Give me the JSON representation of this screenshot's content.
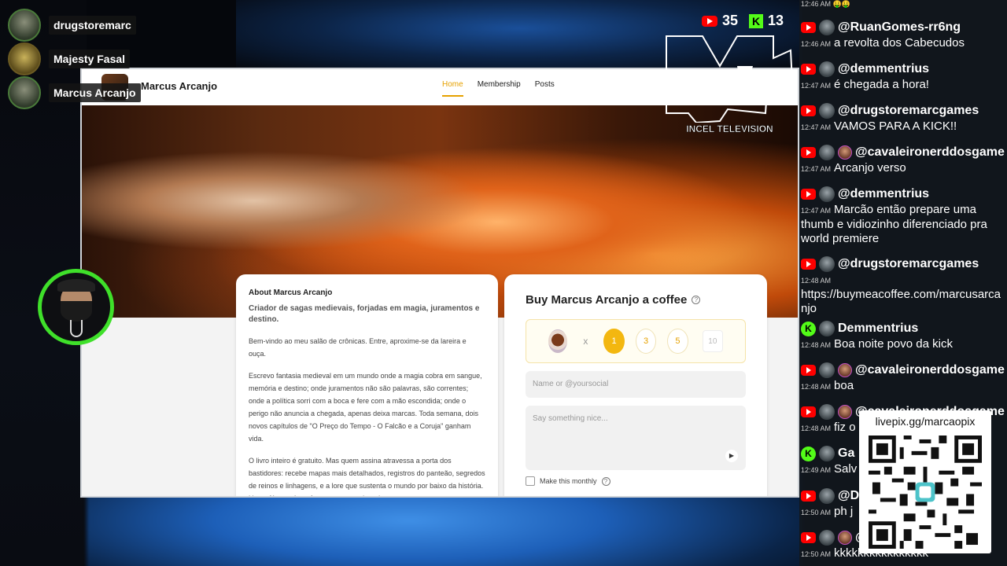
{
  "viewers": [
    {
      "name": "drugstoremarc"
    },
    {
      "name": "Majesty Fasal"
    },
    {
      "name": "Marcus Arcanjo"
    }
  ],
  "counters": {
    "youtube": "35",
    "kick": "13",
    "kick_letter": "K"
  },
  "mtv": {
    "caption": "INCEL TELEVISION"
  },
  "site": {
    "title": "Marcus Arcanjo",
    "nav": [
      "Home",
      "Membership",
      "Posts"
    ]
  },
  "about": {
    "heading": "About Marcus Arcanjo",
    "subtitle": "Criador de sagas medievais, forjadas em magia, juramentos e destino.",
    "paragraphs": [
      "Bem-vindo ao meu salão de crônicas. Entre, aproxime-se da lareira e ouça.",
      "Escrevo fantasia medieval em um mundo onde a magia cobra em sangue, memória e destino; onde juramentos não são palavras, são correntes; onde a política sorri com a boca e fere com a mão escondida; onde o perigo não anuncia a chegada, apenas deixa marcas. Toda semana, dois novos capítulos de \"O Preço do Tempo - O Falcão e a Coruja\" ganham vida.",
      "O livro inteiro é gratuito. Mas quem assina atravessa a porta dos bastidores: recebe mapas mais detalhados, registros do panteão, segredos de reinos e linhagens, e a lore que sustenta o mundo por baixo da história. Um café mantém o fogo aceso, e a tinta do"
    ]
  },
  "coffee": {
    "title": "Buy Marcus Arcanjo a coffee",
    "help": "?",
    "times": "x",
    "amounts": [
      "1",
      "3",
      "5"
    ],
    "custom_amount": "10",
    "name_placeholder": "Name or @yoursocial",
    "message_placeholder": "Say something nice...",
    "monthly_label": "Make this monthly"
  },
  "chat": {
    "first_time": "12:46 AM",
    "first_emotes": "🤑🤑",
    "messages": [
      {
        "platform": "yt",
        "user": "@RuanGomes-rr6ng",
        "time": "12:46 AM",
        "text": "a revolta dos Cabecudos"
      },
      {
        "platform": "yt",
        "user": "@demmentrius",
        "time": "12:47 AM",
        "text": "é chegada a hora!"
      },
      {
        "platform": "yt",
        "user": "@drugstoremarcgames",
        "time": "12:47 AM",
        "text": "VAMOS PARA A KICK!!"
      },
      {
        "platform": "yt",
        "user": "@cavaleironerddosgame",
        "time": "12:47 AM",
        "text": "Arcanjo verso"
      },
      {
        "platform": "yt",
        "user": "@demmentrius",
        "time": "12:47 AM",
        "text": "Marcão então prepare uma thumb e vidiozinho diferenciado pra world premiere"
      },
      {
        "platform": "yt",
        "user": "@drugstoremarcgames",
        "time": "12:48 AM",
        "text": "https://buymeacoffee.com/marcusarcanjo"
      },
      {
        "platform": "kick",
        "user": "Demmentrius",
        "time": "12:48 AM",
        "text": "Boa noite povo da kick"
      },
      {
        "platform": "yt",
        "user": "@cavaleironerddosgame",
        "time": "12:48 AM",
        "text": "boa"
      },
      {
        "platform": "yt",
        "user": "@cavaleironerddosgame",
        "time": "12:48 AM",
        "text": "fiz o"
      },
      {
        "platform": "kick",
        "user": "Ga",
        "time": "12:49 AM",
        "text": "Salv"
      },
      {
        "platform": "yt",
        "user": "@D",
        "time": "12:50 AM",
        "text": "ph j"
      },
      {
        "platform": "yt",
        "user": "@",
        "time": "12:50 AM",
        "text": "kkkkkkkkkkkkkkkk"
      }
    ]
  },
  "qr": {
    "label": "livepix.gg/marcaopix"
  },
  "colors": {
    "accent": "#f3b710",
    "nav_active": "#e6a100",
    "kick_green": "#53fc18",
    "youtube_red": "#ff0000",
    "avatar_ring": "#3fe02a"
  }
}
